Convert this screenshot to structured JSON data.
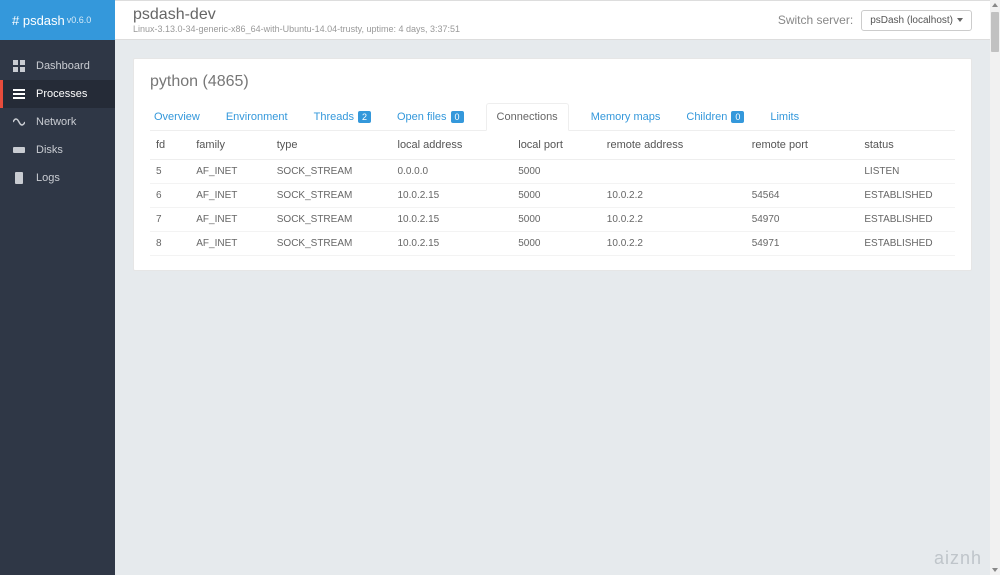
{
  "brand": {
    "name": "# psdash",
    "version": "v0.6.0"
  },
  "sidebar": {
    "items": [
      {
        "label": "Dashboard"
      },
      {
        "label": "Processes"
      },
      {
        "label": "Network"
      },
      {
        "label": "Disks"
      },
      {
        "label": "Logs"
      }
    ]
  },
  "header": {
    "title": "psdash-dev",
    "subtitle": "Linux-3.13.0-34-generic-x86_64-with-Ubuntu-14.04-trusty, uptime: 4 days, 3:37:51",
    "switch_label": "Switch server:",
    "switch_value": "psDash (localhost)"
  },
  "panel": {
    "title": "python (4865)",
    "tabs": [
      {
        "label": "Overview"
      },
      {
        "label": "Environment"
      },
      {
        "label": "Threads",
        "badge": "2"
      },
      {
        "label": "Open files",
        "badge": "0"
      },
      {
        "label": "Connections"
      },
      {
        "label": "Memory maps"
      },
      {
        "label": "Children",
        "badge": "0"
      },
      {
        "label": "Limits"
      }
    ],
    "columns": [
      "fd",
      "family",
      "type",
      "local address",
      "local port",
      "remote address",
      "remote port",
      "status"
    ],
    "rows": [
      {
        "fd": "5",
        "family": "AF_INET",
        "type": "SOCK_STREAM",
        "laddr": "0.0.0.0",
        "lport": "5000",
        "raddr": "",
        "rport": "",
        "status": "LISTEN"
      },
      {
        "fd": "6",
        "family": "AF_INET",
        "type": "SOCK_STREAM",
        "laddr": "10.0.2.15",
        "lport": "5000",
        "raddr": "10.0.2.2",
        "rport": "54564",
        "status": "ESTABLISHED"
      },
      {
        "fd": "7",
        "family": "AF_INET",
        "type": "SOCK_STREAM",
        "laddr": "10.0.2.15",
        "lport": "5000",
        "raddr": "10.0.2.2",
        "rport": "54970",
        "status": "ESTABLISHED"
      },
      {
        "fd": "8",
        "family": "AF_INET",
        "type": "SOCK_STREAM",
        "laddr": "10.0.2.15",
        "lport": "5000",
        "raddr": "10.0.2.2",
        "rport": "54971",
        "status": "ESTABLISHED"
      }
    ]
  },
  "watermark": "aiznh"
}
